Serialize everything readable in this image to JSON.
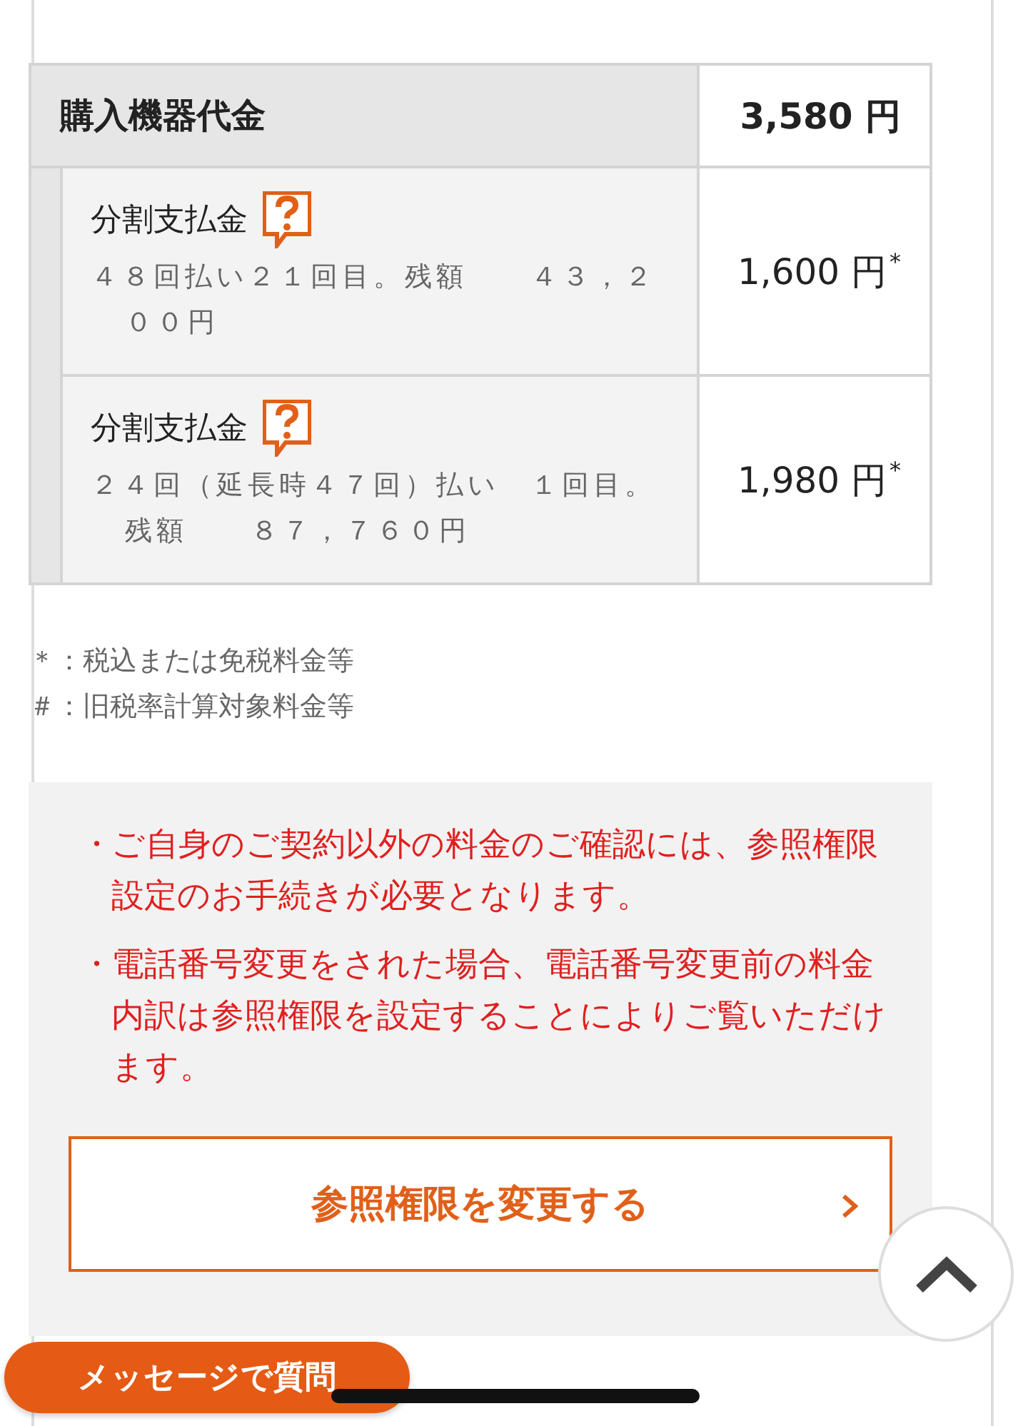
{
  "device_charges": {
    "label": "購入機器代金",
    "amount": "3,580 円",
    "items": [
      {
        "label": "分割支払金",
        "detail": "４８回払い２１回目。残額　　４３，２００円",
        "amount": "1,600 円",
        "mark": "*"
      },
      {
        "label": "分割支払金",
        "detail": "２４回（延長時４７回）払い　１回目。残額　　８７，７６０円",
        "amount": "1,980 円",
        "mark": "*"
      }
    ]
  },
  "notes": [
    "＊：税込または免税料金等",
    "＃：旧税率計算対象料金等"
  ],
  "notice": {
    "bullets": [
      {
        "marker": "・",
        "text": "ご自身のご契約以外の料金のご確認には、参照権限設定のお手続きが必要となります。"
      },
      {
        "marker": "・",
        "text": "電話番号変更をされた場合、電話番号変更前の料金内訳は参照権限を設定することによりご覧いただけます。"
      }
    ],
    "button": "参照権限を変更する"
  },
  "message_button": "メッセージで質問"
}
